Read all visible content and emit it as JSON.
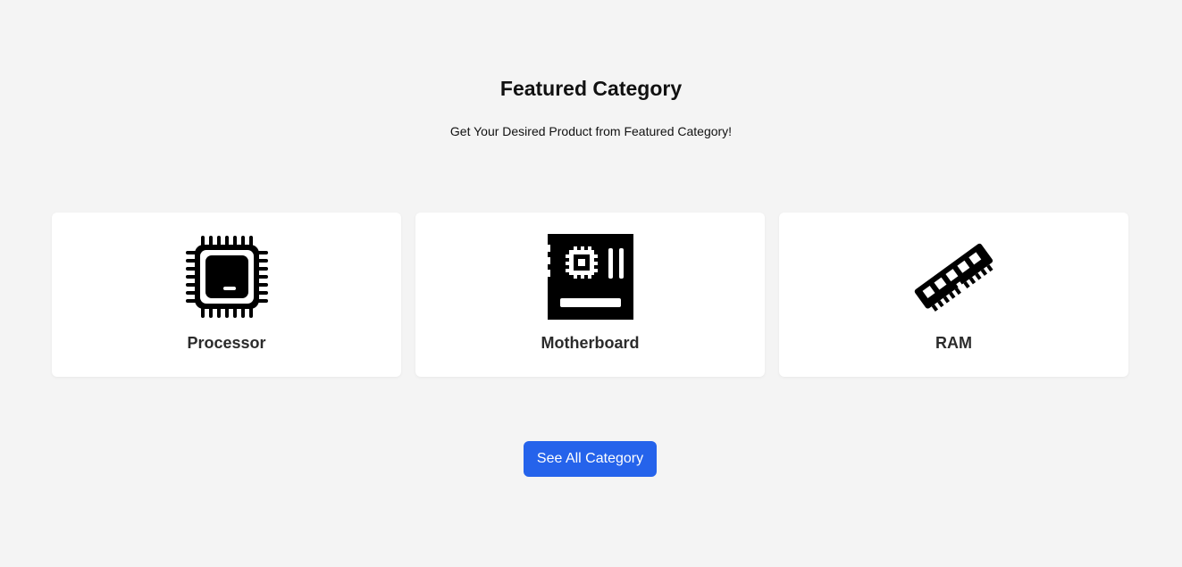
{
  "section": {
    "title": "Featured Category",
    "subtitle": "Get Your Desired Product from Featured Category!"
  },
  "categories": [
    {
      "label": "Processor",
      "icon": "cpu-icon"
    },
    {
      "label": "Motherboard",
      "icon": "motherboard-icon"
    },
    {
      "label": "RAM",
      "icon": "ram-icon"
    }
  ],
  "cta": {
    "label": "See All Category",
    "color": "#2563eb"
  },
  "colors": {
    "background": "#f4f4f4",
    "card": "#ffffff",
    "text": "#111111"
  }
}
